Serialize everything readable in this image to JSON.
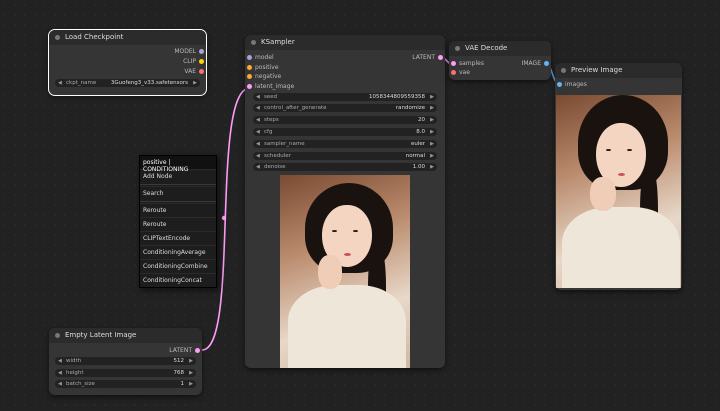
{
  "colors": {
    "background": "#222222",
    "node": "#353535",
    "title": "#2b2b2b",
    "wire_latent": "#ff9cf9",
    "wire_image": "#64b5f6",
    "pin_model": "#b39ddb",
    "pin_clip": "#ffd500",
    "pin_vae": "#ff6e6e",
    "pin_conditioning": "#ffa931",
    "pin_latent": "#ff9cf9",
    "pin_image": "#64b5f6"
  },
  "load_checkpoint": {
    "title": "Load Checkpoint",
    "outputs": [
      "MODEL",
      "CLIP",
      "VAE"
    ],
    "widget_label": "ckpt_name",
    "widget_value": "3Guofeng3_v33.safetensors"
  },
  "ksampler": {
    "title": "KSampler",
    "inputs": [
      "model",
      "positive",
      "negative",
      "latent_image"
    ],
    "output": "LATENT",
    "widgets": [
      {
        "label": "seed",
        "value": "1058344809559358"
      },
      {
        "label": "control_after_generate",
        "value": "randomize"
      },
      {
        "label": "steps",
        "value": "20"
      },
      {
        "label": "cfg",
        "value": "8.0"
      },
      {
        "label": "sampler_name",
        "value": "euler"
      },
      {
        "label": "scheduler",
        "value": "normal"
      },
      {
        "label": "denoise",
        "value": "1.00"
      }
    ]
  },
  "vae_decode": {
    "title": "VAE Decode",
    "inputs": [
      "samples",
      "vae"
    ],
    "output": "IMAGE"
  },
  "preview_image": {
    "title": "Preview Image",
    "input": "images"
  },
  "empty_latent": {
    "title": "Empty Latent Image",
    "output": "LATENT",
    "widgets": [
      {
        "label": "width",
        "value": "512"
      },
      {
        "label": "height",
        "value": "768"
      },
      {
        "label": "batch_size",
        "value": "1"
      }
    ]
  },
  "context_menu": {
    "header": "positive | CONDITIONING",
    "items_top": [
      "Add Node"
    ],
    "items_mid": [
      "Search"
    ],
    "items": [
      "Reroute",
      "Reroute",
      "CLIPTextEncode",
      "ConditioningAverage",
      "ConditioningCombine",
      "ConditioningConcat"
    ]
  }
}
